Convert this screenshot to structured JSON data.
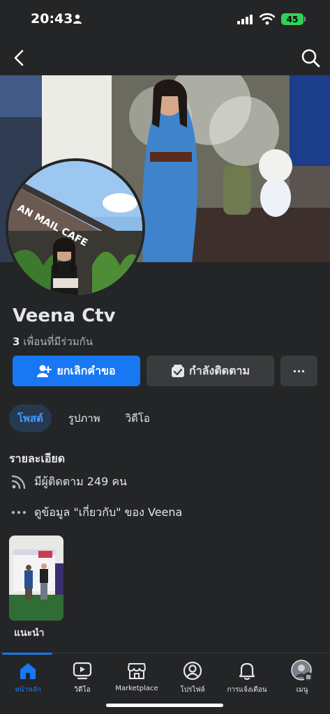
{
  "status": {
    "time": "20:43",
    "battery": "45"
  },
  "profile": {
    "name": "Veena Ctv",
    "mutual_count": "3",
    "mutual_text": "เพื่อนที่มีร่วมกัน"
  },
  "actions": {
    "cancel_request": "ยกเลิกคำขอ",
    "following": "กำลังติดตาม",
    "more": "···"
  },
  "tabs": [
    {
      "label": "โพสต์"
    },
    {
      "label": "รูปภาพ"
    },
    {
      "label": "วิดีโอ"
    }
  ],
  "details": {
    "title": "รายละเอียด",
    "followers": "มีผู้ติดตาม 249 คน",
    "about": "ดูข้อมูล \"เกี่ยวกับ\" ของ Veena"
  },
  "featured": {
    "label": "แนะนำ"
  },
  "cover_sign": "AN MAIL CAFE",
  "bottom_nav": [
    {
      "label": "หน้าหลัก",
      "icon": "home-icon"
    },
    {
      "label": "วิดีโอ",
      "icon": "video-icon"
    },
    {
      "label": "Marketplace",
      "icon": "marketplace-icon"
    },
    {
      "label": "โปรไฟล์",
      "icon": "profile-icon"
    },
    {
      "label": "การแจ้งเตือน",
      "icon": "bell-icon"
    },
    {
      "label": "เมนู",
      "icon": "menu-avatar-icon"
    }
  ],
  "colors": {
    "accent": "#1877f2",
    "background": "#242526",
    "button_secondary": "#3a3b3c",
    "battery": "#30d158"
  }
}
